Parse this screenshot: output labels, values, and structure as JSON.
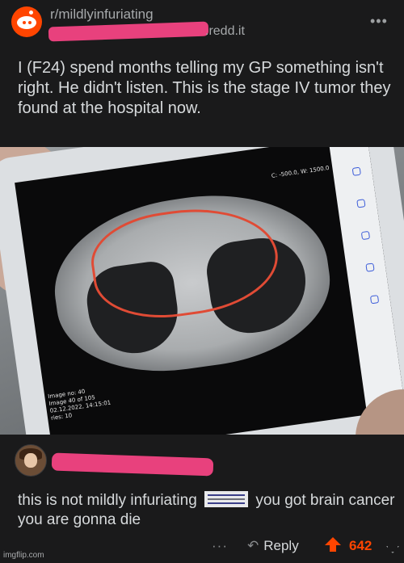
{
  "post": {
    "subreddit": "r/mildlyinfuriating",
    "domain": ".redd.it",
    "title": "I (F24) spend months telling my GP something isn't right. He didn't listen. This is the stage IV tumor they found at the hospital now."
  },
  "scan": {
    "header": "C: -500.0, W: 1500.0",
    "info": "Image no: 40\nImage 40 of 105\n02.12.2022, 14:15:01\nries: 10"
  },
  "comment": {
    "text_before": "this is not mildly infuriating",
    "text_after": "you got brain cancer you are gonna die",
    "more_label": "···",
    "reply_label": "Reply",
    "score": "642"
  },
  "watermark": "imgflip.com",
  "colors": {
    "accent": "#ff4500",
    "redaction": "#e8417d",
    "background": "#1a1a1b"
  }
}
